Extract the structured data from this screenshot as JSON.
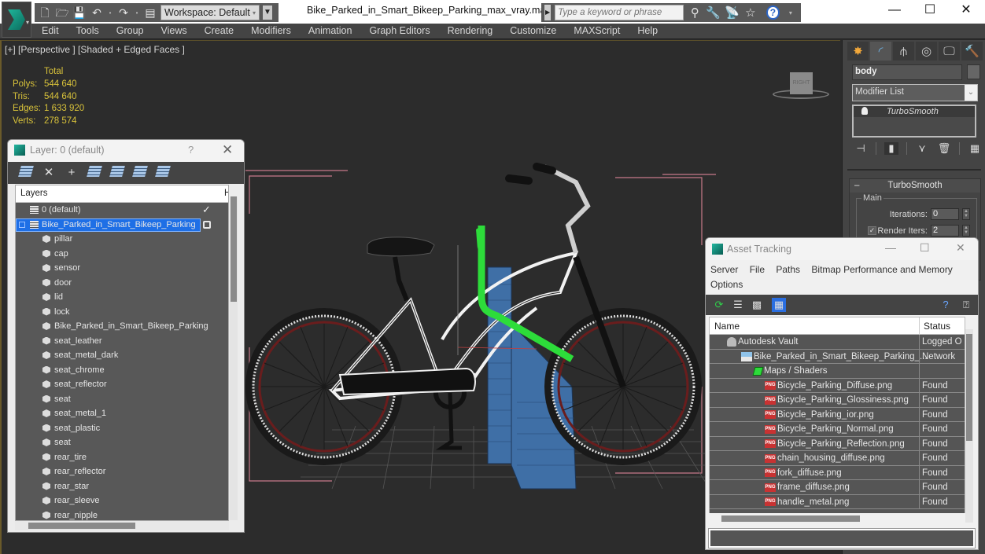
{
  "app": {
    "document_title": "Bike_Parked_in_Smart_Bikeep_Parking_max_vray.max",
    "workspace": "Workspace: Default",
    "search_placeholder": "Type a keyword or phrase",
    "quick_access": [
      "new-icon",
      "open-icon",
      "save-icon",
      "undo-icon",
      "redo-icon",
      "project-folder-icon"
    ],
    "window_controls": {
      "minimize": "—",
      "maximize": "☐",
      "close": "✕"
    }
  },
  "menu": [
    "Edit",
    "Tools",
    "Group",
    "Views",
    "Create",
    "Modifiers",
    "Animation",
    "Graph Editors",
    "Rendering",
    "Customize",
    "MAXScript",
    "Help"
  ],
  "viewport": {
    "label": "[+] [Perspective ] [Shaded + Edged Faces ]",
    "stats": {
      "header": "Total",
      "rows": [
        {
          "key": "Polys:",
          "value": "544 640"
        },
        {
          "key": "Tris:",
          "value": "544 640"
        },
        {
          "key": "Edges:",
          "value": "1 633 920"
        },
        {
          "key": "Verts:",
          "value": "278 574"
        }
      ]
    },
    "viewcube_label": "RIGHT"
  },
  "command_panel": {
    "tabs": [
      "create-icon",
      "modify-icon",
      "hierarchy-icon",
      "motion-icon",
      "display-icon",
      "utilities-icon"
    ],
    "object_name": "body",
    "modifier_list": "Modifier List",
    "stack": [
      "TurboSmooth"
    ],
    "rollout": {
      "title": "TurboSmooth",
      "group": "Main",
      "iterations_label": "Iterations:",
      "iterations": "0",
      "render_iters_label": "Render Iters:",
      "render_iters": "2",
      "render_iters_checked": true
    }
  },
  "layer_dialog": {
    "title": "Layer: 0 (default)",
    "help": "?",
    "column_header": "Layers",
    "column_header_2": "H",
    "layers": [
      {
        "label": "0 (default)",
        "type": "layer",
        "active": true
      },
      {
        "label": "Bike_Parked_in_Smart_Bikeep_Parking",
        "type": "layer",
        "selected": true
      }
    ],
    "objects": [
      "pillar",
      "cap",
      "sensor",
      "door",
      "lid",
      "lock",
      "Bike_Parked_in_Smart_Bikeep_Parking",
      "seat_leather",
      "seat_metal_dark",
      "seat_chrome",
      "seat_reflector",
      "seat",
      "seat_metal_1",
      "seat_plastic",
      "seat",
      "rear_tire",
      "rear_reflector",
      "rear_star",
      "rear_sleeve",
      "rear_nipple"
    ]
  },
  "asset_tracking": {
    "title": "Asset Tracking",
    "menu": [
      "Server",
      "File",
      "Paths",
      "Bitmap Performance and Memory",
      "Options"
    ],
    "columns": [
      "Name",
      "Status"
    ],
    "rows": [
      {
        "name": "Autodesk Vault",
        "status": "Logged O",
        "level": 0,
        "icon": "vault"
      },
      {
        "name": "Bike_Parked_in_Smart_Bikeep_Parking_...",
        "status": "Network",
        "level": 1,
        "icon": "network"
      },
      {
        "name": "Maps / Shaders",
        "status": "",
        "level": 2,
        "icon": "maps"
      },
      {
        "name": "Bicycle_Parking_Diffuse.png",
        "status": "Found",
        "level": 3,
        "icon": "png"
      },
      {
        "name": "Bicycle_Parking_Glossiness.png",
        "status": "Found",
        "level": 3,
        "icon": "png"
      },
      {
        "name": "Bicycle_Parking_ior.png",
        "status": "Found",
        "level": 3,
        "icon": "png"
      },
      {
        "name": "Bicycle_Parking_Normal.png",
        "status": "Found",
        "level": 3,
        "icon": "png"
      },
      {
        "name": "Bicycle_Parking_Reflection.png",
        "status": "Found",
        "level": 3,
        "icon": "png"
      },
      {
        "name": "chain_housing_diffuse.png",
        "status": "Found",
        "level": 3,
        "icon": "png"
      },
      {
        "name": "fork_diffuse.png",
        "status": "Found",
        "level": 3,
        "icon": "png"
      },
      {
        "name": "frame_diffuse.png",
        "status": "Found",
        "level": 3,
        "icon": "png"
      },
      {
        "name": "handle_metal.png",
        "status": "Found",
        "level": 3,
        "icon": "png"
      }
    ]
  },
  "colors": {
    "accent_blue": "#1e6fe6",
    "stats_yellow": "#d8c23a",
    "selection_green": "#2ddc3a",
    "pillar_blue": "#3f6fa6"
  }
}
